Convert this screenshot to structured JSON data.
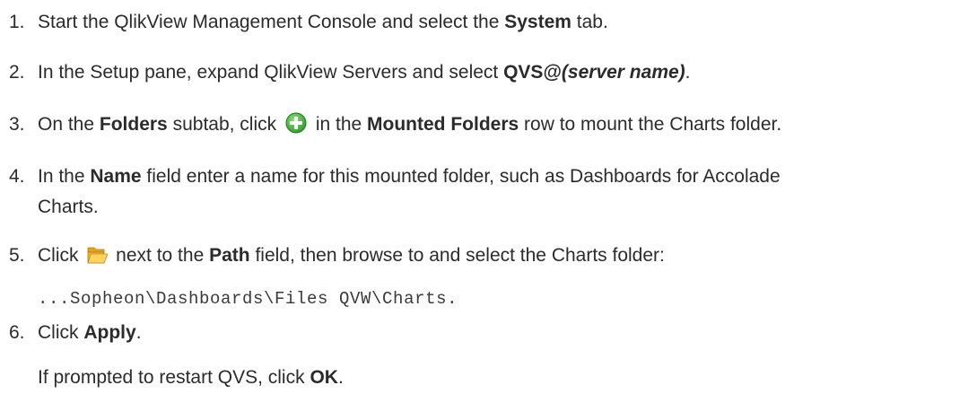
{
  "steps": [
    {
      "number": "1.",
      "parts": [
        "Start the QlikView Management Console and select the ",
        "System",
        " tab."
      ]
    },
    {
      "number": "2.",
      "parts": [
        "In the Setup pane, expand QlikView Servers and select ",
        "QVS@",
        "(server name)",
        "."
      ]
    },
    {
      "number": "3.",
      "parts": [
        "On the ",
        "Folders",
        " subtab, click ",
        " in the ",
        "Mounted Folders",
        " row to mount the Charts folder."
      ]
    },
    {
      "number": "4.",
      "parts": [
        "In the ",
        "Name",
        " field enter a name for this mounted folder, such as Dashboards for Accolade",
        "Charts."
      ]
    },
    {
      "number": "5.",
      "parts": [
        "Click ",
        " next to the ",
        "Path",
        " field, then browse to and select the Charts folder:"
      ],
      "path": "...Sopheon\\Dashboards\\Files QVW\\Charts."
    },
    {
      "number": "6.",
      "parts": [
        "Click ",
        "Apply",
        "."
      ],
      "note": [
        "If prompted to restart QVS, click ",
        "OK",
        "."
      ]
    }
  ],
  "icons": {
    "add": "plus-circle-icon",
    "folder": "open-folder-icon"
  },
  "colors": {
    "text": "#2b2b2b",
    "add_icon": "#3fb23a",
    "folder_icon": "#f2b233"
  }
}
